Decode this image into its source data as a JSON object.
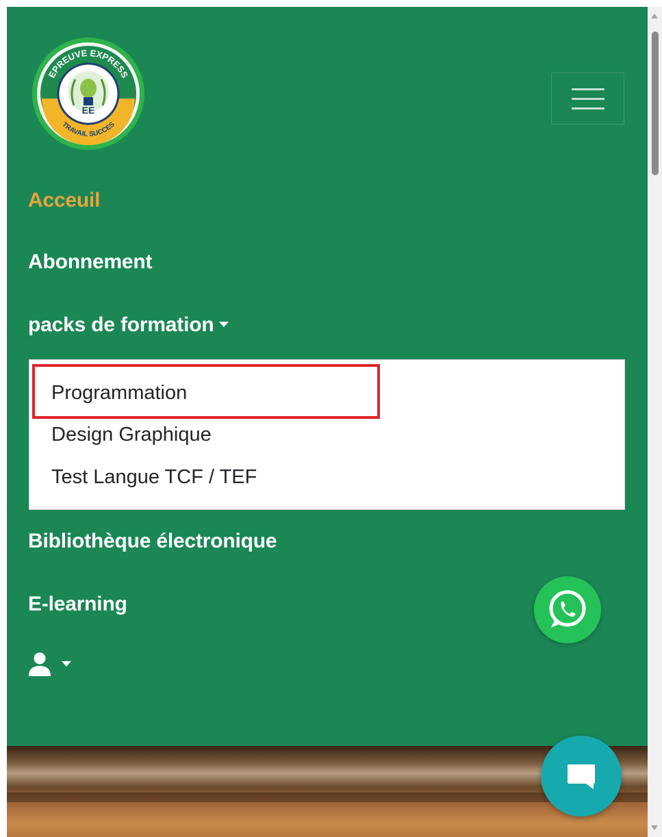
{
  "navbar": {
    "background": "#1a8755",
    "logo": {
      "top_text": "EPREUVE EXPRESS",
      "center_text": "EE",
      "bottom_text": "TRAVAIL SUCCES"
    },
    "links": [
      {
        "label": "Acceuil",
        "active": true,
        "color": "#e8a33d"
      },
      {
        "label": "Abonnement"
      },
      {
        "label": "packs de formation"
      },
      {
        "label": "Bibliothèque électronique"
      },
      {
        "label": "E-learning"
      }
    ],
    "dropdown": {
      "items": [
        {
          "label": "Programmation",
          "highlighted": true
        },
        {
          "label": "Design Graphique"
        },
        {
          "label": "Test Langue TCF / TEF"
        }
      ],
      "highlight_color": "#e0232a"
    },
    "user_menu": {
      "icon": "user-icon"
    }
  },
  "floating": {
    "whatsapp": {
      "icon": "whatsapp-icon",
      "color": "#25c259"
    },
    "chat": {
      "icon": "chat-icon",
      "color": "#16a9ae"
    }
  }
}
